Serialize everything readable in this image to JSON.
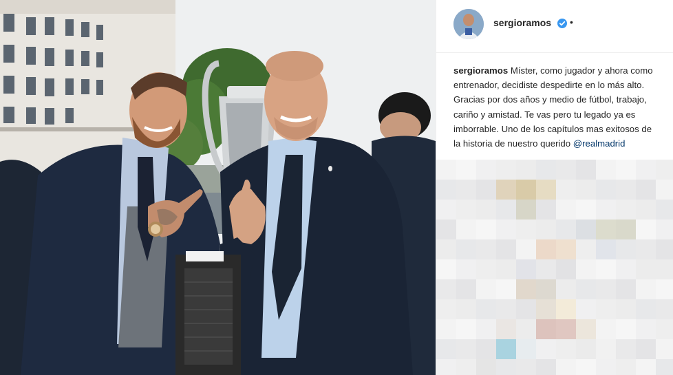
{
  "post": {
    "username": "sergioramos",
    "separator": "•",
    "verified": true,
    "caption_username": "sergioramos",
    "caption_text": " Míster, como jugador y ahora como entrenador, decidiste despedirte en lo más alto. Gracias por dos años y medio de fútbol, trabajo, cariño y amistad. Te vas pero tu legado ya es imborrable. Uno de los capítulos mas exitosos de la historia de nuestro querido ",
    "mention": "@realmadrid"
  },
  "colors": {
    "verified_blue": "#3897f0",
    "mention_blue": "#003569",
    "text": "#262626"
  },
  "icons": {
    "verified": "verified-badge-icon"
  }
}
